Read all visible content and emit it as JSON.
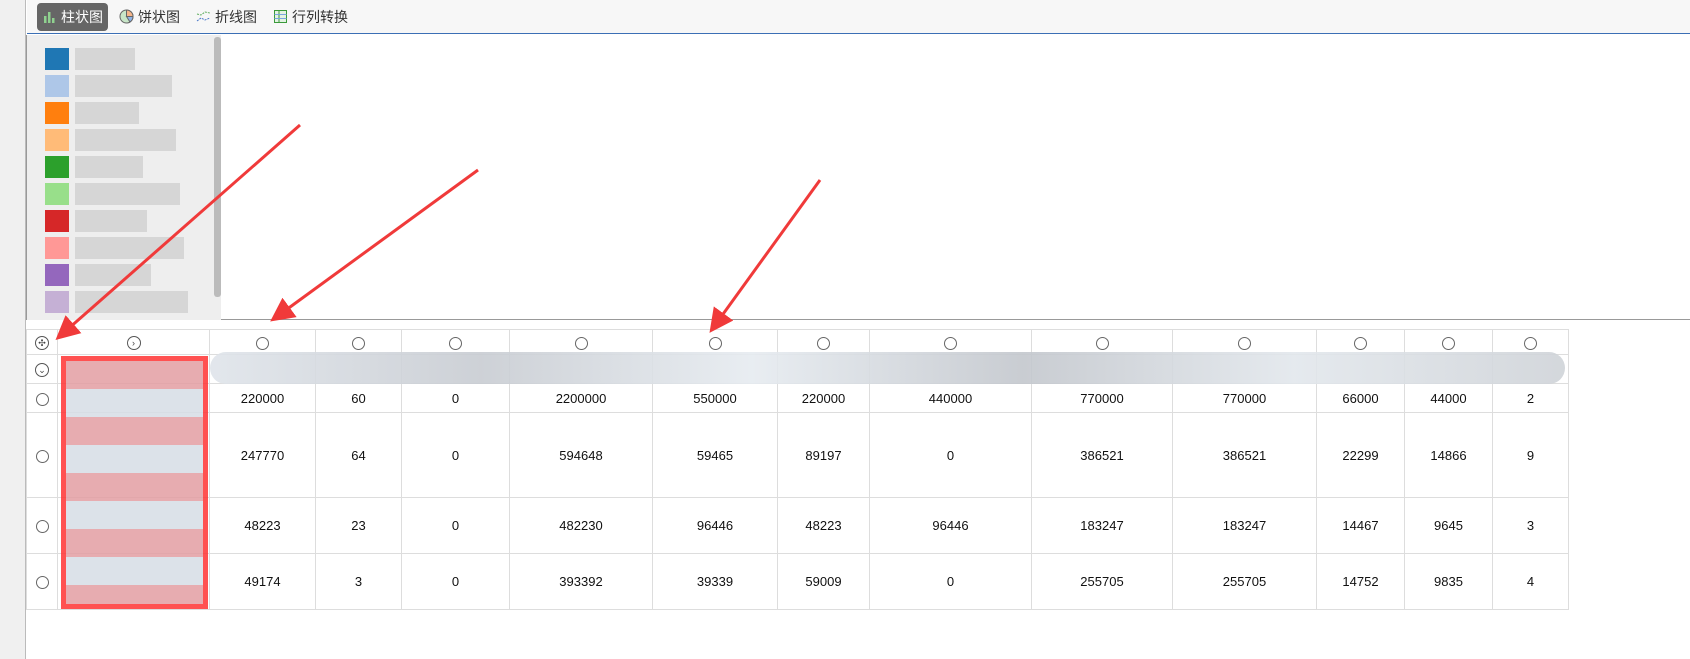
{
  "toolbar": {
    "items": [
      {
        "label": "柱状图",
        "icon": "bar-chart-icon",
        "active": true
      },
      {
        "label": "饼状图",
        "icon": "pie-chart-icon"
      },
      {
        "label": "折线图",
        "icon": "line-chart-icon"
      },
      {
        "label": "行列转换",
        "icon": "transpose-icon"
      }
    ]
  },
  "legend": {
    "colors": [
      "#1f77b4",
      "#aec7e8",
      "#ff7f0e",
      "#ffbb78",
      "#2ca02c",
      "#98df8a",
      "#d62728",
      "#ff9896",
      "#9467bd",
      "#c5b0d5"
    ]
  },
  "table": {
    "rows": [
      [
        "220000",
        "60",
        "0",
        "2200000",
        "550000",
        "220000",
        "440000",
        "770000",
        "770000",
        "66000",
        "44000",
        "2"
      ],
      [
        "247770",
        "64",
        "0",
        "594648",
        "59465",
        "89197",
        "0",
        "386521",
        "386521",
        "22299",
        "14866",
        "9"
      ],
      [
        "48223",
        "23",
        "0",
        "482230",
        "96446",
        "48223",
        "96446",
        "183247",
        "183247",
        "14467",
        "9645",
        "3"
      ],
      [
        "49174",
        "3",
        "0",
        "393392",
        "39339",
        "59009",
        "0",
        "255705",
        "255705",
        "14752",
        "9835",
        "4"
      ]
    ]
  },
  "annotation_color": "#f03a3a"
}
